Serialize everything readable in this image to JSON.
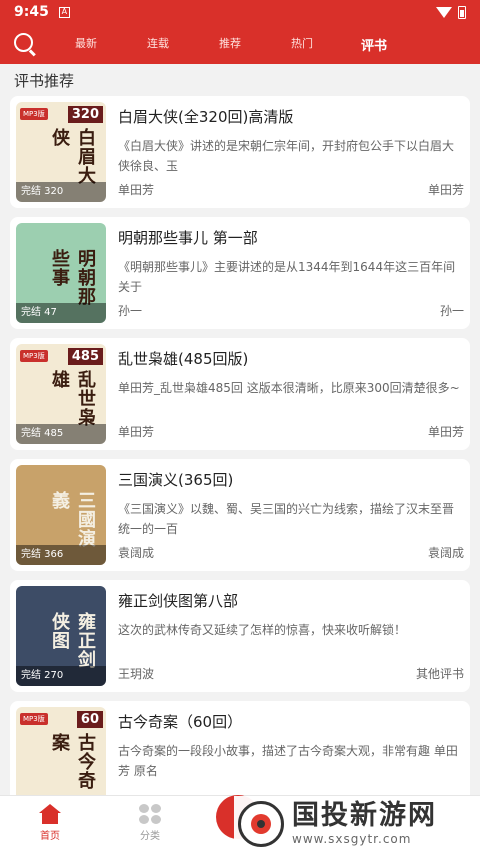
{
  "status": {
    "time": "9:45",
    "sim": "A"
  },
  "nav": {
    "tabs": [
      "最新",
      "连载",
      "推荐",
      "热门",
      "评书"
    ],
    "active_tab": 4
  },
  "section_title": "评书推荐",
  "items": [
    {
      "title": "白眉大侠(全320回)高清版",
      "desc": "《白眉大侠》讲述的是宋朝仁宗年间，开封府包公手下以白眉大侠徐良、玉",
      "author": "单田芳",
      "source": "单田芳",
      "badge": "完结 320",
      "cover_text": "白眉大侠",
      "cover_num": "320",
      "cover_tag": "MP3版",
      "cover_color": "#f3ead4"
    },
    {
      "title": "明朝那些事儿 第一部",
      "desc": "《明朝那些事儿》主要讲述的是从1344年到1644年这三百年间关于",
      "author": "孙一",
      "source": "孙一",
      "badge": "完结 47",
      "cover_text": "明朝那些事",
      "cover_num": "",
      "cover_tag": "",
      "cover_color": "#9ccfb0"
    },
    {
      "title": "乱世枭雄(485回版)",
      "desc": "单田芳_乱世枭雄485回  这版本很清晰，比原来300回清楚很多~",
      "author": "单田芳",
      "source": "单田芳",
      "badge": "完结 485",
      "cover_text": "乱世枭雄",
      "cover_num": "485",
      "cover_tag": "MP3版",
      "cover_color": "#f3ead4"
    },
    {
      "title": "三国演义(365回)",
      "desc": "《三国演义》以魏、蜀、吴三国的兴亡为线索，描绘了汉末至晋统一的一百",
      "author": "袁阔成",
      "source": "袁阔成",
      "badge": "完结 366",
      "cover_text": "三國演義",
      "cover_num": "",
      "cover_tag": "",
      "cover_color": "#c8a26a"
    },
    {
      "title": "雍正剑侠图第八部",
      "desc": "这次的武林传奇又延续了怎样的惊喜，快来收听解锁！",
      "author": "王玥波",
      "source": "其他评书",
      "badge": "完结 270",
      "cover_text": "雍正剑侠图",
      "cover_num": "",
      "cover_tag": "",
      "cover_color": "#3d4c66"
    },
    {
      "title": "古今奇案（60回）",
      "desc": "古今奇案的一段段小故事，描述了古今奇案大观，非常有趣 单田芳 原名",
      "author": "",
      "source": "",
      "badge": "",
      "cover_text": "古今奇案",
      "cover_num": "60",
      "cover_tag": "MP3版",
      "cover_color": "#f3ead4"
    }
  ],
  "bottom_nav": {
    "home": "首页",
    "category": "分类"
  },
  "watermark": {
    "title": "国投新游网",
    "url": "www.sxsgytr.com"
  }
}
